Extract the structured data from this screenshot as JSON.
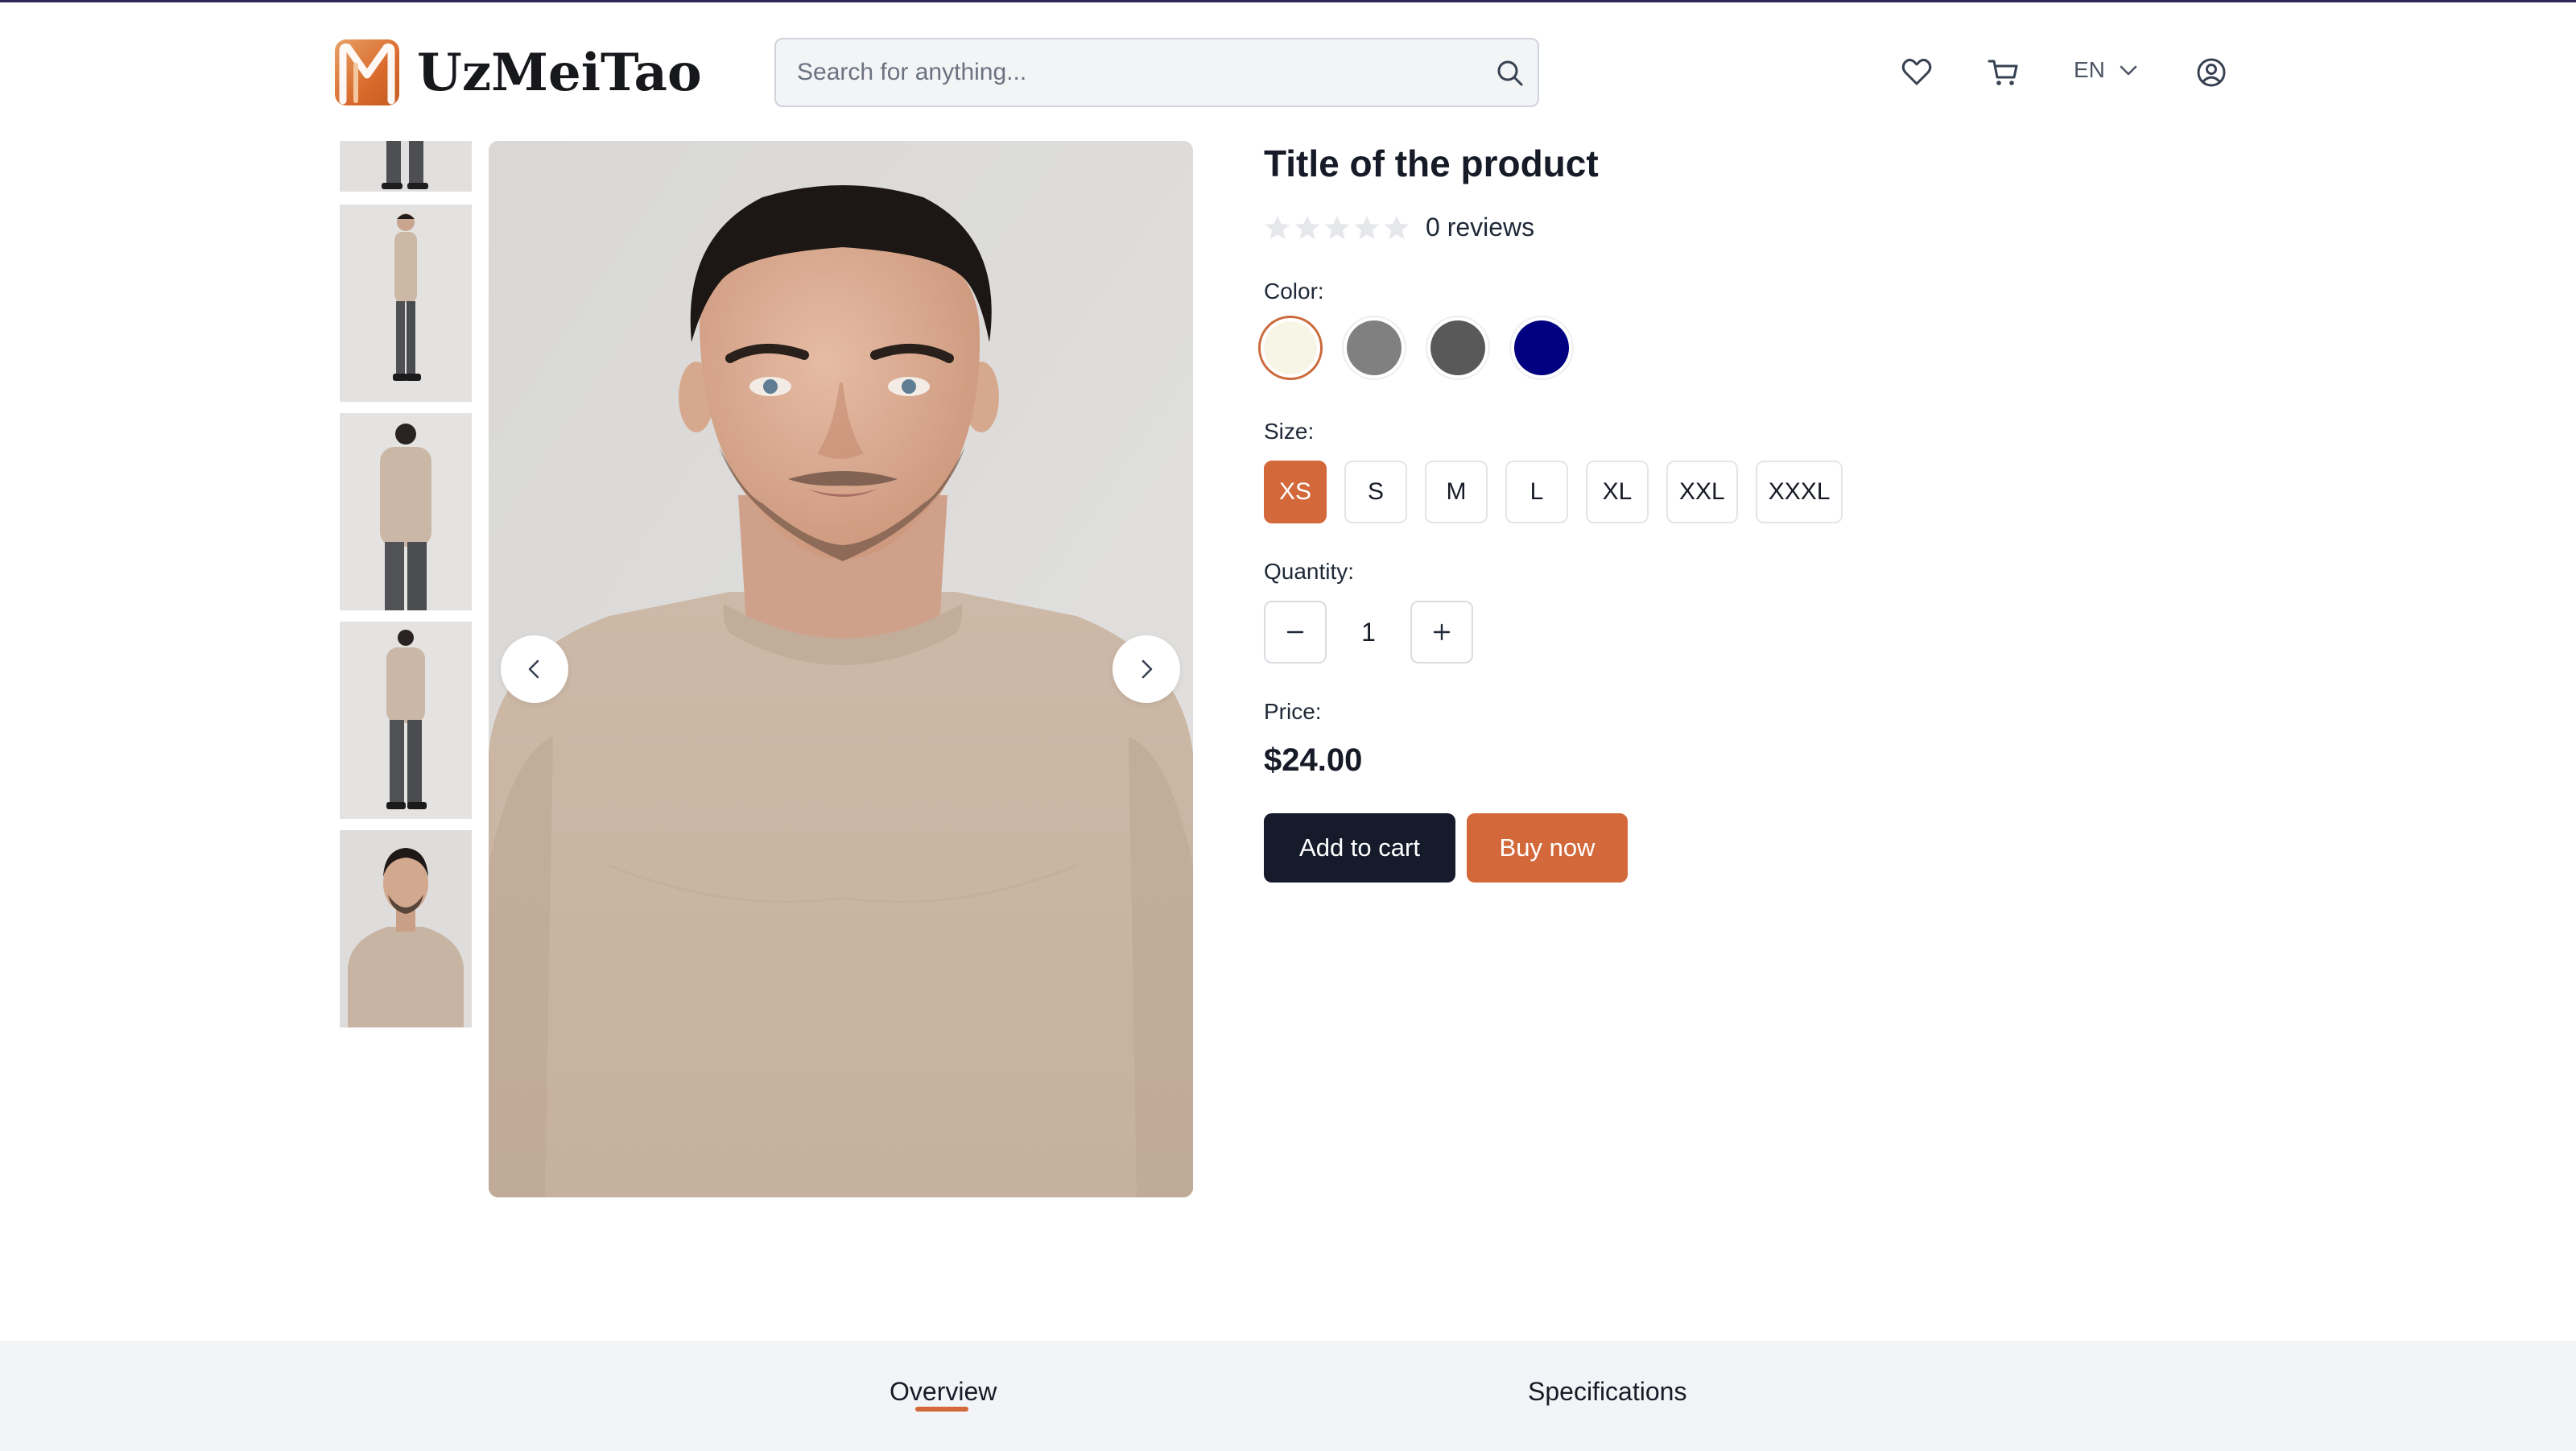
{
  "header": {
    "logo_text": "UzMeiTao",
    "search_placeholder": "Search for anything...",
    "language": "EN",
    "icons": [
      "heart-icon",
      "cart-icon",
      "chevron-down-icon",
      "user-icon",
      "search-icon"
    ]
  },
  "gallery": {
    "thumbnails": [
      "thumbnail-1",
      "thumbnail-2",
      "thumbnail-3",
      "thumbnail-4",
      "thumbnail-5"
    ],
    "prev_icon": "chevron-left-icon",
    "next_icon": "chevron-right-icon"
  },
  "product": {
    "title": "Title of the product",
    "rating_stars": 0,
    "rating_max": 5,
    "reviews_text": "0 reviews",
    "color_label": "Color:",
    "colors": [
      "#f7f6e6",
      "#808080",
      "#595959",
      "#000080"
    ],
    "selected_color_index": 0,
    "size_label": "Size:",
    "sizes": [
      "XS",
      "S",
      "M",
      "L",
      "XL",
      "XXL",
      "XXXL"
    ],
    "selected_size": "XS",
    "quantity_label": "Quantity:",
    "quantity": "1",
    "price_label": "Price:",
    "price": "$24.00",
    "add_to_cart": "Add to cart",
    "buy_now": "Buy now"
  },
  "tabs": {
    "overview": "Overview",
    "specifications": "Specifications",
    "active": "Overview"
  },
  "colors": {
    "accent": "#d3683a",
    "dark_button": "#161b2c",
    "tab_bar_bg": "#f3f4f7"
  }
}
